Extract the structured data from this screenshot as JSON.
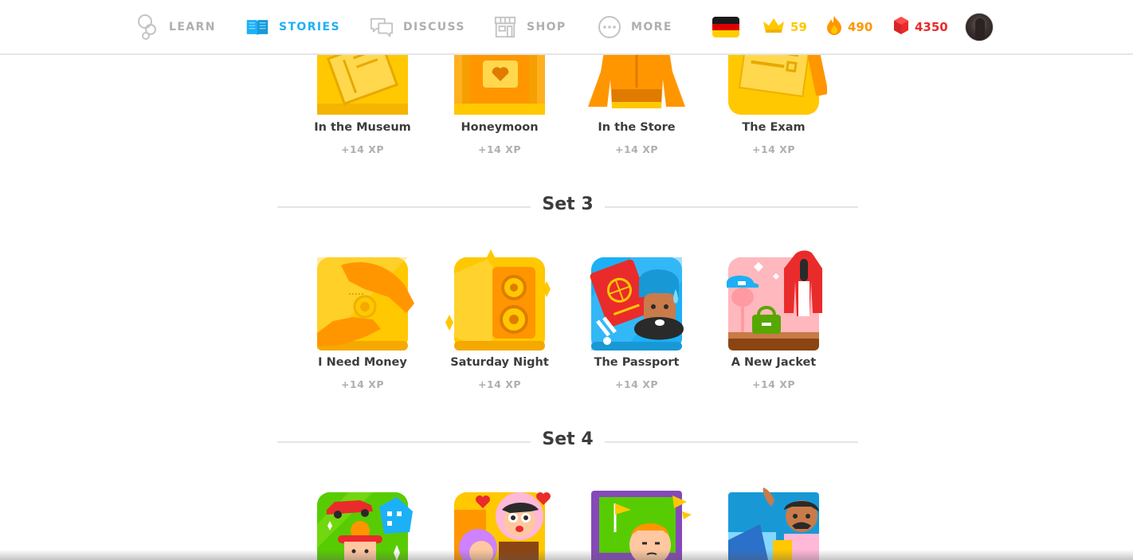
{
  "nav": {
    "learn": "LEARN",
    "stories": "STORIES",
    "discuss": "DISCUSS",
    "shop": "SHOP",
    "more": "MORE"
  },
  "stats": {
    "language_flag": "german-flag",
    "crowns": "59",
    "streak": "490",
    "gems": "4350"
  },
  "colors": {
    "accent": "#1cb0f6",
    "crown": "#ffc800",
    "streak": "#ff9600",
    "gems": "#ea2b2b",
    "muted": "#afafaf"
  },
  "set2_stories": [
    {
      "title": "In the Museum",
      "xp": "+14 XP"
    },
    {
      "title": "Honeymoon",
      "xp": "+14 XP"
    },
    {
      "title": "In the Store",
      "xp": "+14 XP"
    },
    {
      "title": "The Exam",
      "xp": "+14 XP"
    }
  ],
  "set3": {
    "title": "Set 3",
    "stories": [
      {
        "title": "I Need Money",
        "xp": "+14 XP"
      },
      {
        "title": "Saturday Night",
        "xp": "+14 XP"
      },
      {
        "title": "The Passport",
        "xp": "+14 XP"
      },
      {
        "title": "A New Jacket",
        "xp": "+14 XP"
      }
    ]
  },
  "set4": {
    "title": "Set 4"
  }
}
